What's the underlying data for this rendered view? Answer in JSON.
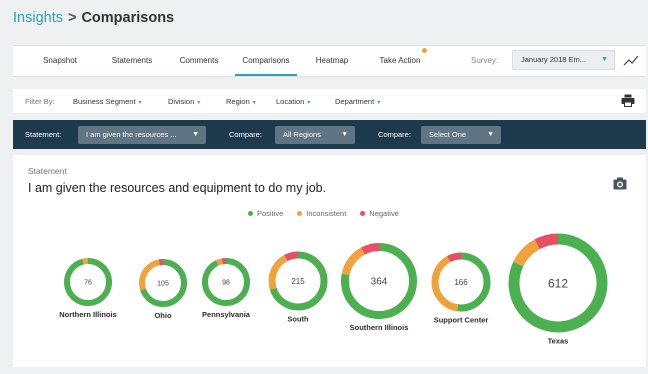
{
  "breadcrumb": {
    "parent": "Insights",
    "separator": ">",
    "current": "Comparisons"
  },
  "tabs": [
    {
      "label": "Snapshot",
      "active": false
    },
    {
      "label": "Statements",
      "active": false
    },
    {
      "label": "Comments",
      "active": false
    },
    {
      "label": "Comparisons",
      "active": true
    },
    {
      "label": "Heatmap",
      "active": false
    },
    {
      "label": "Take Action",
      "active": false,
      "badge": true
    }
  ],
  "survey": {
    "label": "Survey:",
    "value": "January 2018 Em...",
    "icon": "chevron-down-icon"
  },
  "trend_icon": "trend-line-icon",
  "filters": {
    "label": "Filter By:",
    "items": [
      "Business Segment",
      "Division",
      "Region",
      "Location",
      "Department"
    ],
    "print_icon": "printer-icon"
  },
  "statement_bar": {
    "statement_label": "Statement:",
    "statement_value": "I am given the resources ...",
    "compare1_label": "Compare:",
    "compare1_value": "All Regions",
    "compare2_label": "Compare:",
    "compare2_value": "Select One"
  },
  "panel": {
    "label": "Statement",
    "text": "I am given the resources and equipment to do my job.",
    "camera_icon": "camera-icon"
  },
  "legend": [
    {
      "name": "Positive",
      "color": "#4caf50"
    },
    {
      "name": "Inconsistent",
      "color": "#f0a23c"
    },
    {
      "name": "Negative",
      "color": "#e94f64"
    }
  ],
  "colors": {
    "positive": "#4caf50",
    "inconsistent": "#f0a23c",
    "negative": "#e94f64",
    "accent": "#2aa3b5",
    "darkbar": "#1d3a4c"
  },
  "donuts": [
    {
      "name": "Northern Illinois",
      "count": 76,
      "positive": 0.96,
      "inconsistent": 0.04,
      "negative": 0.0
    },
    {
      "name": "Ohio",
      "count": 105,
      "positive": 0.7,
      "inconsistent": 0.27,
      "negative": 0.03
    },
    {
      "name": "Pennsylvania",
      "count": 98,
      "positive": 0.93,
      "inconsistent": 0.04,
      "negative": 0.03
    },
    {
      "name": "South",
      "count": 215,
      "positive": 0.7,
      "inconsistent": 0.22,
      "negative": 0.08
    },
    {
      "name": "Southern Illinois",
      "count": 364,
      "positive": 0.78,
      "inconsistent": 0.14,
      "negative": 0.08
    },
    {
      "name": "Support Center",
      "count": 166,
      "positive": 0.52,
      "inconsistent": 0.4,
      "negative": 0.08
    },
    {
      "name": "Texas",
      "count": 612,
      "positive": 0.82,
      "inconsistent": 0.1,
      "negative": 0.08
    }
  ]
}
